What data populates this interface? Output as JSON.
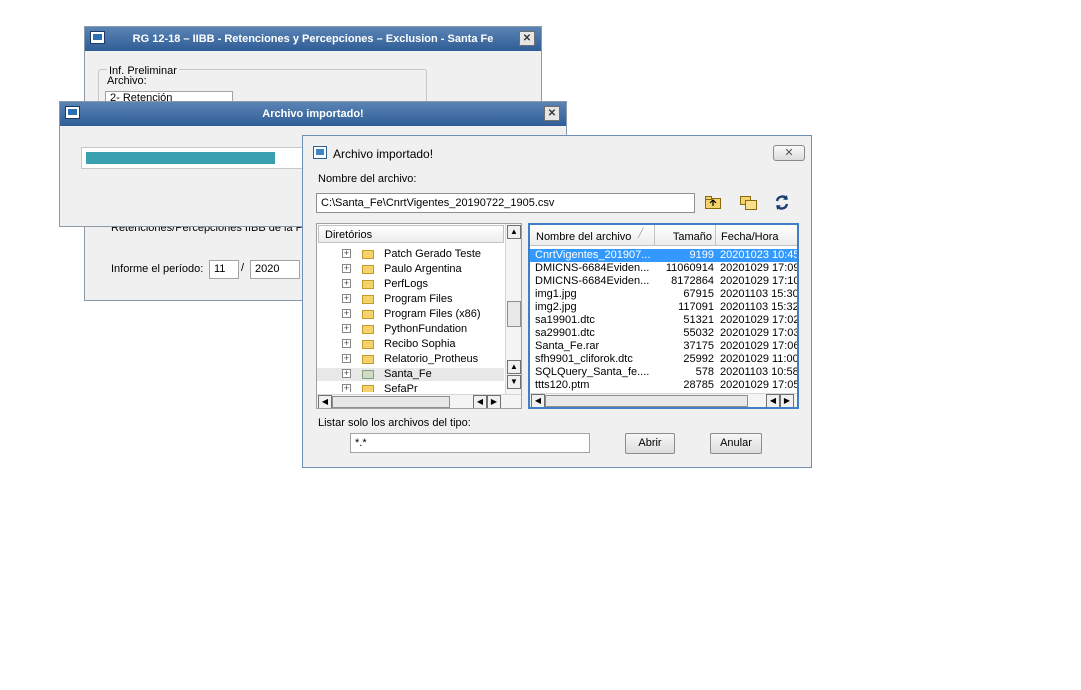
{
  "bg_window": {
    "title": "RG 12-18 – IIBB - Retenciones y Percepciones – Exclusion - Santa Fe",
    "group_label": "Inf. Preliminar",
    "archivo_label": "Archivo:",
    "combo_value": "2- Retención",
    "ret_text": "Retenciones/Percepciones IIBB de la P",
    "periodo_label": "Informe el período:",
    "month": "11",
    "slash": "/",
    "year": "2020"
  },
  "progress_window": {
    "title": "Archivo importado!",
    "progress_fraction": 0.43
  },
  "file_dialog": {
    "title": "Archivo importado!",
    "filename_label": "Nombre del archivo:",
    "filename_value": "C:\\Santa_Fe\\CnrtVigentes_20190722_1905.csv",
    "tree_header": "Diretórios",
    "folders": [
      "Patch Gerado Teste",
      "Paulo Argentina",
      "PerfLogs",
      "Program Files",
      "Program Files (x86)",
      "PythonFundation",
      "Recibo Sophia",
      "Relatorio_Protheus",
      "Santa_Fe",
      "SefaPr"
    ],
    "selected_folder": "Santa_Fe",
    "columns": [
      "Nombre del archivo",
      "Tamaño",
      "Fecha/Hora"
    ],
    "files": [
      {
        "name": "CnrtVigentes_201907...",
        "size": "9199",
        "date": "20201023 10:45",
        "selected": true
      },
      {
        "name": "DMICNS-6684Eviden...",
        "size": "11060914",
        "date": "20201029 17:09"
      },
      {
        "name": "DMICNS-6684Eviden...",
        "size": "8172864",
        "date": "20201029 17:10"
      },
      {
        "name": "img1.jpg",
        "size": "67915",
        "date": "20201103 15:30"
      },
      {
        "name": "img2.jpg",
        "size": "117091",
        "date": "20201103 15:32"
      },
      {
        "name": "sa19901.dtc",
        "size": "51321",
        "date": "20201029 17:02"
      },
      {
        "name": "sa29901.dtc",
        "size": "55032",
        "date": "20201029 17:03"
      },
      {
        "name": "Santa_Fe.rar",
        "size": "37175",
        "date": "20201029 17:06"
      },
      {
        "name": "sfh9901_cliforok.dtc",
        "size": "25992",
        "date": "20201029 11:00"
      },
      {
        "name": "SQLQuery_Santa_fe....",
        "size": "578",
        "date": "20201103 10:58"
      },
      {
        "name": "ttts120.ptm",
        "size": "28785",
        "date": "20201029 17:05"
      }
    ],
    "filter_label": "Listar solo los archivos del tipo:",
    "filter_value": "*.*",
    "open_label": "Abrir",
    "cancel_label": "Anular",
    "icons": [
      "folder-up-icon",
      "folder-new-icon",
      "refresh-icon"
    ],
    "selection_color": "#3399ff"
  },
  "colors": {
    "title_bar": "#2f5d95",
    "progress": "#3aa0b0"
  }
}
